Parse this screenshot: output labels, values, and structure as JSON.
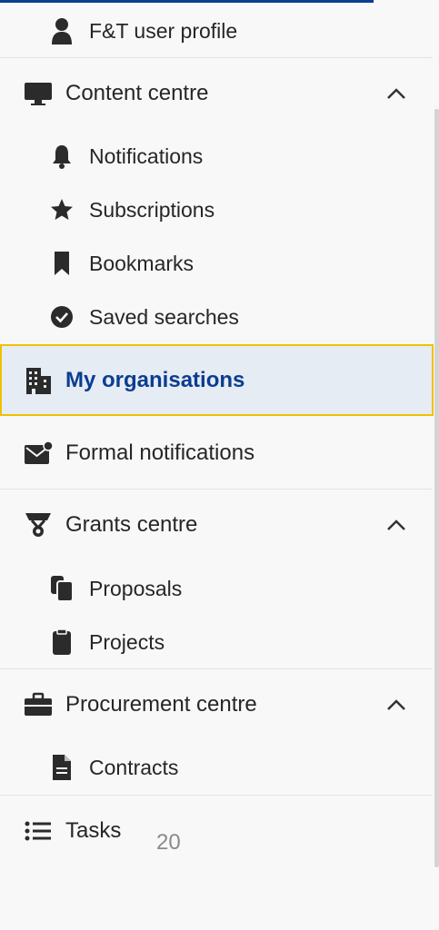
{
  "menu": {
    "profile": {
      "label": "F&T user profile",
      "icon": "user-icon"
    },
    "content_centre": {
      "label": "Content centre",
      "icon": "monitor-icon",
      "items": [
        {
          "label": "Notifications",
          "icon": "bell-icon"
        },
        {
          "label": "Subscriptions",
          "icon": "star-icon"
        },
        {
          "label": "Bookmarks",
          "icon": "bookmark-icon"
        },
        {
          "label": "Saved searches",
          "icon": "check-circle-icon"
        }
      ]
    },
    "my_organisations": {
      "label": "My organisations",
      "icon": "building-icon",
      "active": true
    },
    "formal_notifications": {
      "label": "Formal notifications",
      "icon": "envelope-icon"
    },
    "grants_centre": {
      "label": "Grants centre",
      "icon": "grant-icon",
      "items": [
        {
          "label": "Proposals",
          "icon": "documents-icon"
        },
        {
          "label": "Projects",
          "icon": "clipboard-icon"
        }
      ]
    },
    "procurement_centre": {
      "label": "Procurement centre",
      "icon": "briefcase-icon",
      "items": [
        {
          "label": "Contracts",
          "icon": "file-icon"
        }
      ]
    },
    "tasks": {
      "label": "Tasks",
      "icon": "list-icon"
    }
  },
  "page_number": "20",
  "colors": {
    "active_text": "#0b3d91",
    "active_bg": "#e6ecf4",
    "active_border": "#f0c000",
    "text": "#262626"
  }
}
